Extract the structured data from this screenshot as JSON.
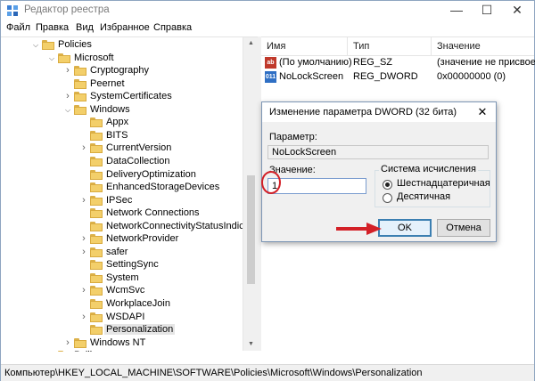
{
  "window": {
    "title": "Редактор реестра",
    "controls": {
      "minimize": "—",
      "maximize": "☐",
      "close": "✕"
    }
  },
  "menu": [
    "Файл",
    "Правка",
    "Вид",
    "Избранное",
    "Справка"
  ],
  "tree": [
    {
      "label": "Policies",
      "level": 0,
      "expander": "open"
    },
    {
      "label": "Microsoft",
      "level": 1,
      "expander": "open"
    },
    {
      "label": "Cryptography",
      "level": 2,
      "expander": "closed"
    },
    {
      "label": "Peernet",
      "level": 2,
      "expander": "none"
    },
    {
      "label": "SystemCertificates",
      "level": 2,
      "expander": "closed"
    },
    {
      "label": "Windows",
      "level": 2,
      "expander": "open"
    },
    {
      "label": "Appx",
      "level": 3,
      "expander": "none"
    },
    {
      "label": "BITS",
      "level": 3,
      "expander": "none"
    },
    {
      "label": "CurrentVersion",
      "level": 3,
      "expander": "closed"
    },
    {
      "label": "DataCollection",
      "level": 3,
      "expander": "none"
    },
    {
      "label": "DeliveryOptimization",
      "level": 3,
      "expander": "none"
    },
    {
      "label": "EnhancedStorageDevices",
      "level": 3,
      "expander": "none"
    },
    {
      "label": "IPSec",
      "level": 3,
      "expander": "closed"
    },
    {
      "label": "Network Connections",
      "level": 3,
      "expander": "none"
    },
    {
      "label": "NetworkConnectivityStatusIndicator",
      "level": 3,
      "expander": "none"
    },
    {
      "label": "NetworkProvider",
      "level": 3,
      "expander": "closed"
    },
    {
      "label": "safer",
      "level": 3,
      "expander": "closed"
    },
    {
      "label": "SettingSync",
      "level": 3,
      "expander": "none"
    },
    {
      "label": "System",
      "level": 3,
      "expander": "none"
    },
    {
      "label": "WcmSvc",
      "level": 3,
      "expander": "closed"
    },
    {
      "label": "WorkplaceJoin",
      "level": 3,
      "expander": "none"
    },
    {
      "label": "WSDAPI",
      "level": 3,
      "expander": "closed"
    },
    {
      "label": "Personalization",
      "level": 3,
      "expander": "none",
      "selected": true
    },
    {
      "label": "Windows NT",
      "level": 2,
      "expander": "closed"
    },
    {
      "label": "Psilic",
      "level": 1,
      "expander": "closed"
    }
  ],
  "list": {
    "columns": [
      "Имя",
      "Тип",
      "Значение"
    ],
    "rows": [
      {
        "icon": "string-value-icon",
        "icon_text": "ab",
        "name": "(По умолчанию)",
        "type": "REG_SZ",
        "value": "(значение не присвоено)"
      },
      {
        "icon": "dword-value-icon",
        "icon_text": "011",
        "name": "NoLockScreen",
        "type": "REG_DWORD",
        "value": "0x00000000 (0)"
      }
    ]
  },
  "dialog": {
    "title": "Изменение параметра DWORD (32 бита)",
    "close": "✕",
    "param_label": "Параметр:",
    "param_value": "NoLockScreen",
    "value_label": "Значение:",
    "value_input": "1",
    "base_group_title": "Система исчисления",
    "base_options": [
      "Шестнадцатеричная",
      "Десятичная"
    ],
    "base_selected": 0,
    "ok_label": "OK",
    "cancel_label": "Отмена"
  },
  "status": {
    "path": "Компьютер\\HKEY_LOCAL_MACHINE\\SOFTWARE\\Policies\\Microsoft\\Windows\\Personalization"
  },
  "colors": {
    "annotation_red": "#d32027",
    "selection_gray": "#e5e5e5",
    "folder_yellow": "#f3cf6a"
  }
}
